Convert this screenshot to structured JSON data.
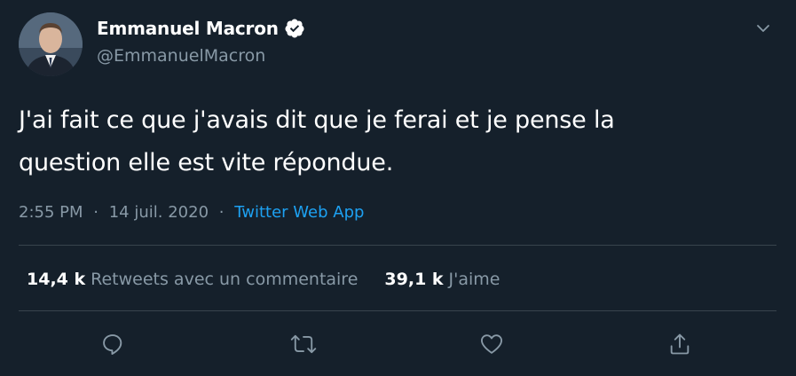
{
  "tweet": {
    "author": {
      "display_name": "Emmanuel Macron",
      "handle": "@EmmanuelMacron",
      "verified": true,
      "avatar_icon": "profile-photo"
    },
    "text": "J'ai fait ce que j'avais dit que je ferai et je pense la\nquestion elle est vite répondue.",
    "time": "2:55 PM",
    "separator": "·",
    "date": "14 juil. 2020",
    "source": "Twitter Web App",
    "stats": {
      "retweets_count": "14,4 k",
      "retweets_label": "Retweets avec un commentaire",
      "likes_count": "39,1 k",
      "likes_label": "J'aime"
    },
    "actions": {
      "reply_icon": "reply-icon",
      "retweet_icon": "retweet-icon",
      "like_icon": "heart-icon",
      "share_icon": "share-icon"
    }
  },
  "theme": {
    "background": "#15202b",
    "text_primary": "#ffffff",
    "text_secondary": "#8899a6",
    "accent": "#1da1f2",
    "divider": "#38444d"
  }
}
